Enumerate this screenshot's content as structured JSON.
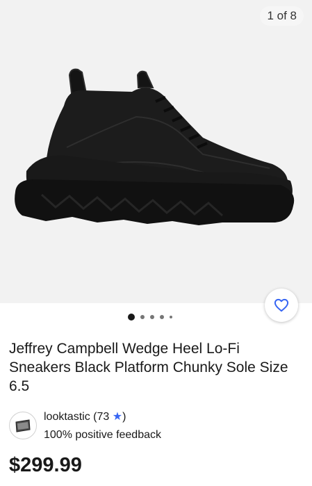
{
  "gallery": {
    "counter": "1 of 8",
    "image_icon": "black-chunky-sneaker-photo",
    "dots_total": 5,
    "active_dot": 1
  },
  "watch": {
    "icon": "heart-icon"
  },
  "item": {
    "title": "Jeffrey Campbell Wedge Heel Lo-Fi Sneakers Black Platform Chunky Sole Size 6.5"
  },
  "seller": {
    "name": "looktastic",
    "score_open": "(73",
    "score_close": ")",
    "star_icon": "star-icon",
    "feedback": "100% positive feedback"
  },
  "price": "$299.99",
  "colors": {
    "accent": "#3665f3",
    "text": "#191919",
    "gallery_bg": "#f2f2f2"
  }
}
